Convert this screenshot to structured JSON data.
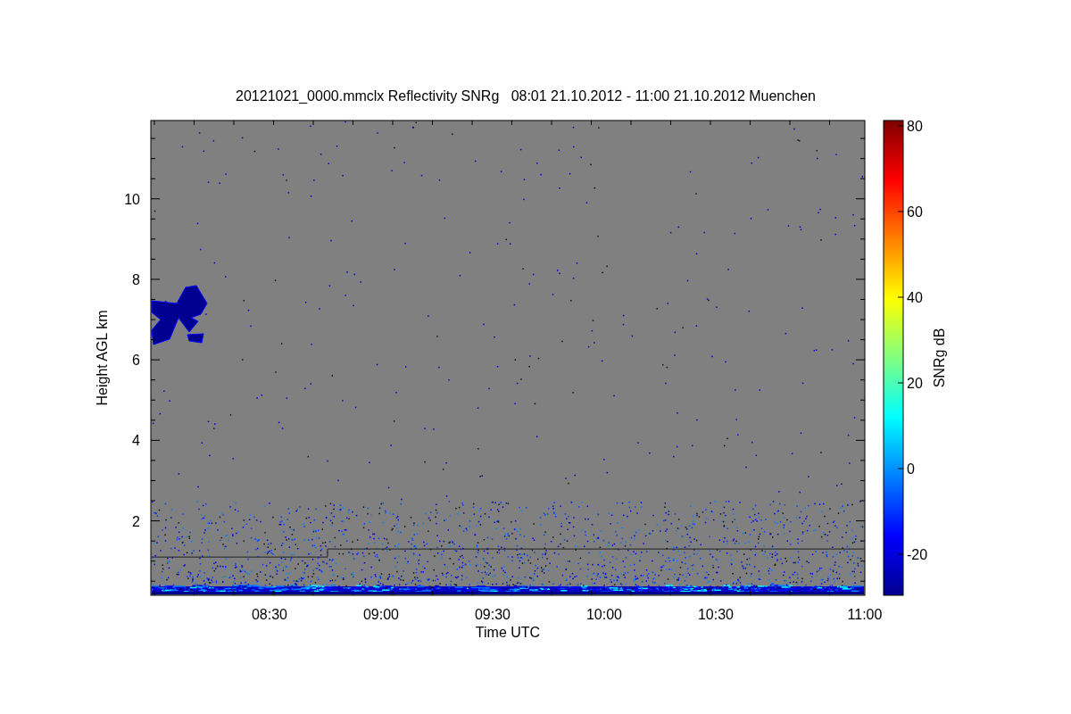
{
  "title": "20121021_0000.mmclx Reflectivity SNRg   08:01 21.10.2012 - 11:00 21.10.2012 Muenchen",
  "y_axis": {
    "label": "Height AGL km",
    "ticks": [
      "10",
      "8",
      "6",
      "4",
      "2"
    ]
  },
  "x_axis": {
    "label": "Time UTC",
    "ticks": [
      "08:30",
      "09:00",
      "09:30",
      "10:00",
      "10:30",
      "11:00"
    ]
  },
  "colorbar": {
    "label": "SNRg dB",
    "ticks": [
      "80",
      "60",
      "40",
      "20",
      "0",
      "-20"
    ]
  }
}
